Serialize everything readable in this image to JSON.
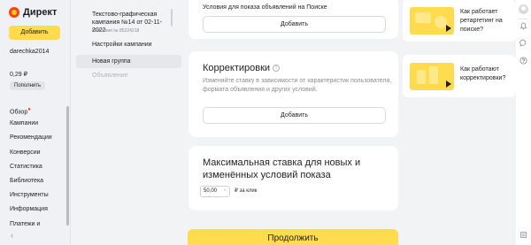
{
  "brand": {
    "name": "Директ"
  },
  "sidebar": {
    "add_label": "Добавить",
    "login": "darechka2014",
    "balance": "0,29 ₽",
    "topup_label": "Пополнить",
    "items": [
      {
        "label": "Обзор",
        "has_dot": true
      },
      {
        "label": "Кампании"
      },
      {
        "label": "Рекомендации"
      },
      {
        "label": "Конверсии"
      },
      {
        "label": "Статистика"
      },
      {
        "label": "Библиотека"
      },
      {
        "label": "Инструменты"
      },
      {
        "label": "Информация"
      },
      {
        "label": "Платежи и"
      }
    ],
    "collapse_glyph": "‹"
  },
  "campaign": {
    "title": "Текстово-графическая кампания №14 от 02-11-2022",
    "number": "Кампания № 85224218",
    "nav": [
      {
        "label": "Настройки кампании"
      },
      {
        "label": "Новая группа",
        "active": true
      },
      {
        "label": "Объявление",
        "disabled": true
      }
    ]
  },
  "main": {
    "conditions": {
      "title": "Условия для показа объявлений на Поиске",
      "button_label": "Добавить"
    },
    "adjustments": {
      "title": "Корректировки",
      "help_glyph": "?",
      "description": "Изменяйте ставку в зависимости от характеристик пользователя, формата объявления и других условий.",
      "button_label": "Добавить"
    },
    "max_bid": {
      "title": "Максимальная ставка для новых и изменённых условий показа",
      "value": "50,00",
      "clear_glyph": "×",
      "unit": "₽ за клик"
    },
    "submit_label": "Продолжить"
  },
  "help": [
    {
      "text": "Как работает ретаргетинг на поиске?"
    },
    {
      "text": "Как работают корректировки?"
    }
  ],
  "colors": {
    "accent": "#ffdb4d",
    "brand_red": "#fc3f1d"
  },
  "rail_icons": [
    "avatar-icon",
    "bell-icon",
    "chat-icon",
    "help-icon",
    "list-icon"
  ]
}
